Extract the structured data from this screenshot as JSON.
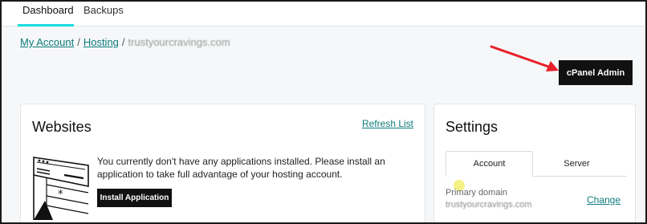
{
  "nav": {
    "tabs": [
      {
        "label": "Dashboard",
        "active": true
      },
      {
        "label": "Backups",
        "active": false
      }
    ]
  },
  "breadcrumb": {
    "items": [
      "My Account",
      "Hosting"
    ],
    "separator": "/",
    "current": "trustyourcravings.com"
  },
  "header": {
    "cpanel_button": "cPanel Admin"
  },
  "websites": {
    "title": "Websites",
    "refresh_label": "Refresh List",
    "empty_message": "You currently don't have any applications installed. Please install an application to take full advantage of your hosting account.",
    "install_label": "Install Application"
  },
  "settings": {
    "title": "Settings",
    "tabs": [
      {
        "label": "Account",
        "active": true
      },
      {
        "label": "Server",
        "active": false
      }
    ],
    "primary_domain_label": "Primary domain",
    "primary_domain_value": "trustyourcravings.com",
    "change_label": "Change"
  },
  "colors": {
    "accent": "#0f7b7b",
    "tab_underline": "#1bdbdb",
    "button_bg": "#111111",
    "arrow": "#e8202a",
    "page_bg": "#f5f7f8"
  }
}
